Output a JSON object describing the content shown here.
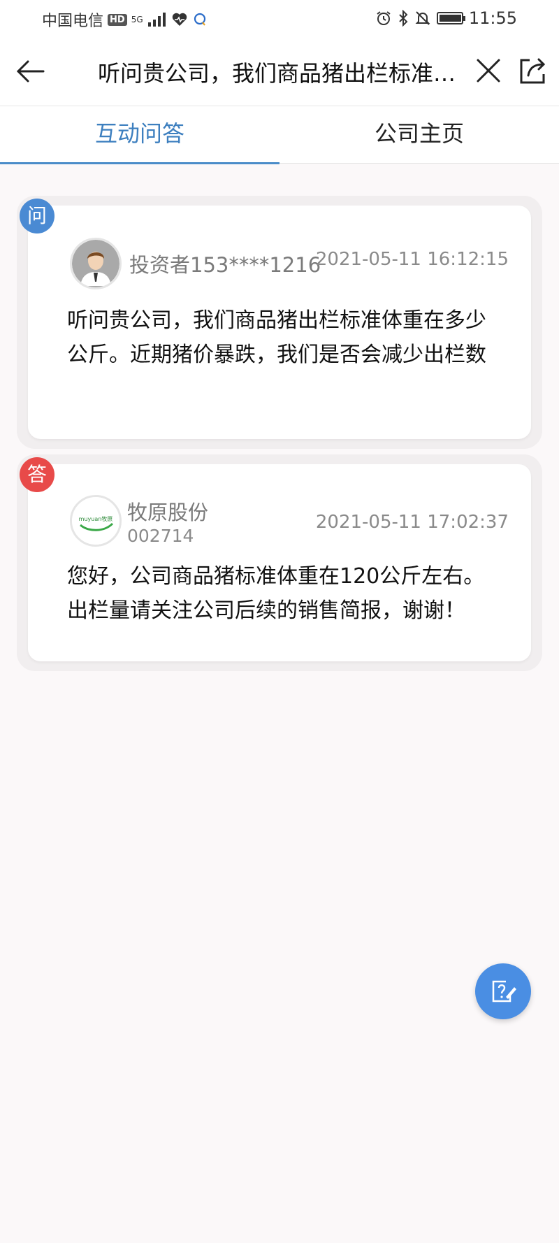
{
  "status_bar": {
    "carrier": "中国电信",
    "hd": "HD",
    "network": "5G",
    "time": "11:55",
    "battery_level": 0.95
  },
  "nav": {
    "title": "听问贵公司，我们商品猪出栏标准体重在多少公斤。近期猪价暴跌，我们是否会减少出栏数",
    "icons": [
      "back-arrow-icon",
      "close-icon",
      "share-icon"
    ]
  },
  "tabs": [
    {
      "label": "互动问答",
      "active": true
    },
    {
      "label": "公司主页",
      "active": false
    }
  ],
  "question": {
    "badge": "问",
    "asker": "投资者153****1216",
    "timestamp": "2021-05-11 16:12:15",
    "text": "听问贵公司，我们商品猪出栏标准体重在多少公斤。近期猪价暴跌，我们是否会减少出栏数"
  },
  "answer": {
    "badge": "答",
    "logo_text": "muyuan牧原",
    "company": "牧原股份",
    "code": "002714",
    "timestamp": "2021-05-11 17:02:37",
    "text": "您好，公司商品猪标准体重在120公斤左右。出栏量请关注公司后续的销售简报，谢谢！"
  },
  "colors": {
    "accent_blue": "#4a8cc9",
    "question_badge": "#4a8ad3",
    "answer_badge": "#e84a49",
    "fab": "#4a8ee3"
  }
}
